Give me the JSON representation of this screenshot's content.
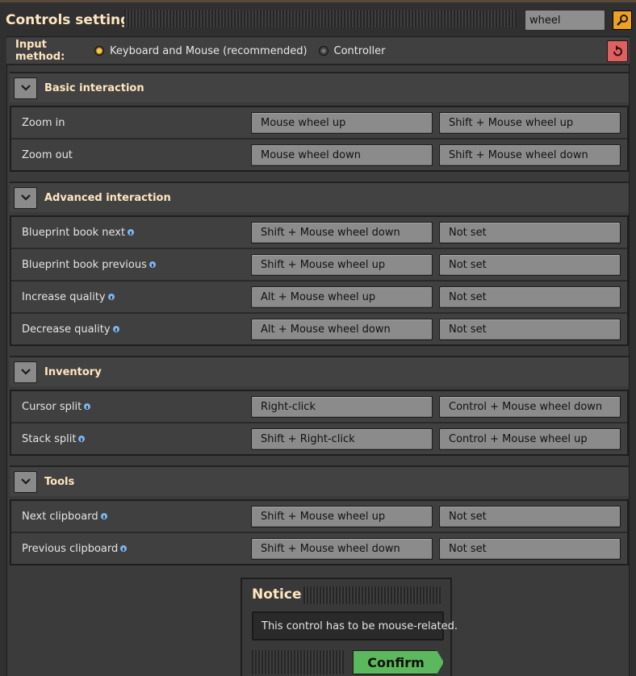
{
  "window": {
    "title": "Controls settings"
  },
  "search": {
    "value": "wheel"
  },
  "input_method": {
    "label": "Input method:",
    "options": [
      {
        "label": "Keyboard and Mouse (recommended)",
        "selected": true
      },
      {
        "label": "Controller",
        "selected": false
      }
    ]
  },
  "sections": [
    {
      "title": "Basic interaction",
      "rows": [
        {
          "label": "Zoom in",
          "info": false,
          "primary": "Mouse wheel up",
          "secondary": "Shift + Mouse wheel up"
        },
        {
          "label": "Zoom out",
          "info": false,
          "primary": "Mouse wheel down",
          "secondary": "Shift + Mouse wheel down"
        }
      ]
    },
    {
      "title": "Advanced interaction",
      "rows": [
        {
          "label": "Blueprint book next",
          "info": true,
          "primary": "Shift + Mouse wheel down",
          "secondary": "Not set"
        },
        {
          "label": "Blueprint book previous",
          "info": true,
          "primary": "Shift + Mouse wheel up",
          "secondary": "Not set"
        },
        {
          "label": "Increase quality",
          "info": true,
          "primary": "Alt + Mouse wheel up",
          "secondary": "Not set"
        },
        {
          "label": "Decrease quality",
          "info": true,
          "primary": "Alt + Mouse wheel down",
          "secondary": "Not set"
        }
      ]
    },
    {
      "title": "Inventory",
      "rows": [
        {
          "label": "Cursor split",
          "info": true,
          "primary": "Right-click",
          "secondary": "Control + Mouse wheel down"
        },
        {
          "label": "Stack split",
          "info": true,
          "primary": "Shift + Right-click",
          "secondary": "Control + Mouse wheel up"
        }
      ]
    },
    {
      "title": "Tools",
      "rows": [
        {
          "label": "Next clipboard",
          "info": true,
          "primary": "Shift + Mouse wheel up",
          "secondary": "Not set"
        },
        {
          "label": "Previous clipboard",
          "info": true,
          "primary": "Shift + Mouse wheel down",
          "secondary": "Not set"
        }
      ]
    }
  ],
  "notice": {
    "title": "Notice",
    "message": "This control has to be mouse-related.",
    "confirm_label": "Confirm"
  },
  "colors": {
    "accent_title": "#ffe6c0",
    "confirm_green": "#5cb85c",
    "search_orange": "#f0a020",
    "reset_red": "#e06060"
  },
  "icons": {
    "search_button": "magnifier-icon",
    "reset_button": "reset-arrow-icon",
    "section_toggle": "chevron-down-icon",
    "info": "info-icon"
  }
}
